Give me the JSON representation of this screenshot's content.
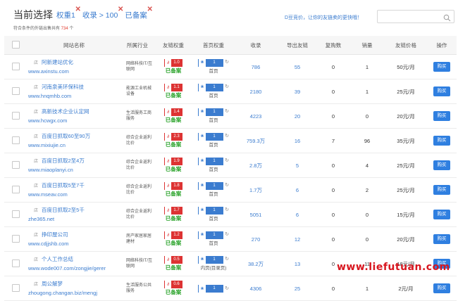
{
  "header": {
    "title": "当前选择",
    "filters": [
      "权重1",
      "收录 > 100",
      "已备案"
    ],
    "summary_prefix": "符合条件的外链出售共有 ",
    "summary_count": "734",
    "summary_suffix": " 个",
    "promo": "D豆竞价，让你的友链卖的更快哦！",
    "search_value": "",
    "search_placeholder": ""
  },
  "table": {
    "headers": [
      "网站名称",
      "所属行业",
      "友链权重",
      "首页权重",
      "收录",
      "导出友链",
      "复购数",
      "销量",
      "友链价格",
      "操作"
    ],
    "beian_label": "已备案",
    "buy_label": "购买",
    "rows": [
      {
        "name": "阿新建站优化",
        "url": "www.axinstu.com",
        "industry": "网络科技IT/互联网",
        "fw": "1.0",
        "sy": "1",
        "sy_text": "首页",
        "sl": "786",
        "dc": "55",
        "fg": "0",
        "xl": "1",
        "price": "50元/月"
      },
      {
        "name": "河南泉美环保科技",
        "url": "www.hnqmhb.com",
        "industry": "能源工业机械设备",
        "fw": "1.1",
        "sy": "1",
        "sy_text": "首页",
        "sl": "2180",
        "dc": "39",
        "fg": "0",
        "xl": "1",
        "price": "25元/月"
      },
      {
        "name": "高新技术企业认定网",
        "url": "www.hcwgx.com",
        "industry": "生活服务工商服务",
        "fw": "1.4",
        "sy": "1",
        "sy_text": "首页",
        "sl": "4223",
        "dc": "20",
        "fg": "0",
        "xl": "0",
        "price": "20元/月"
      },
      {
        "name": "百度日抓取60至90万",
        "url": "www.mixiujie.cn",
        "industry": "综合企业返利比价",
        "fw": "2.3",
        "sy": "1",
        "sy_text": "首页",
        "sl": "759.3万",
        "dc": "16",
        "fg": "7",
        "xl": "96",
        "price": "35元/月"
      },
      {
        "name": "百度日抓取2至4万",
        "url": "www.miaoplanyi.cn",
        "industry": "综合企业返利比价",
        "fw": "1.9",
        "sy": "1",
        "sy_text": "首页",
        "sl": "2.8万",
        "dc": "5",
        "fg": "0",
        "xl": "4",
        "price": "25元/月"
      },
      {
        "name": "百度日抓取5至7千",
        "url": "www.mseav.com",
        "industry": "综合企业返利比价",
        "fw": "1.8",
        "sy": "1",
        "sy_text": "首页",
        "sl": "1.7万",
        "dc": "6",
        "fg": "0",
        "xl": "2",
        "price": "25元/月"
      },
      {
        "name": "百度日抓取2至5千",
        "url": "zhe365.net",
        "industry": "综合企业返利比价",
        "fw": "1.7",
        "sy": "1",
        "sy_text": "首页",
        "sl": "5051",
        "dc": "6",
        "fg": "0",
        "xl": "0",
        "price": "15元/月"
      },
      {
        "name": "挣印屋公司",
        "url": "www.cdjjshb.com",
        "industry": "房产家居家居建材",
        "fw": "1.2",
        "sy": "1",
        "sy_text": "首页",
        "sl": "270",
        "dc": "12",
        "fg": "0",
        "xl": "0",
        "price": "20元/月"
      },
      {
        "name": "个人工作总结",
        "url": "www.wode007.com/zongjie/gerer",
        "industry": "网络科技IT/互联网",
        "fw": "0.5",
        "sy": "1",
        "sy_text": "内页(目录页)",
        "sl": "38.2万",
        "dc": "13",
        "fg": "0",
        "xl": "11",
        "price": "18元/月"
      },
      {
        "name": "周公解梦",
        "url": "zhougong.changan.biz/mengj",
        "industry": "生活服务公共服务",
        "fw": "0.6",
        "sy": "1",
        "sy_text": "",
        "sl": "4306",
        "dc": "25",
        "fg": "0",
        "xl": "1",
        "price": "2元/月"
      }
    ]
  },
  "watermark": "www.liefutuan.com"
}
